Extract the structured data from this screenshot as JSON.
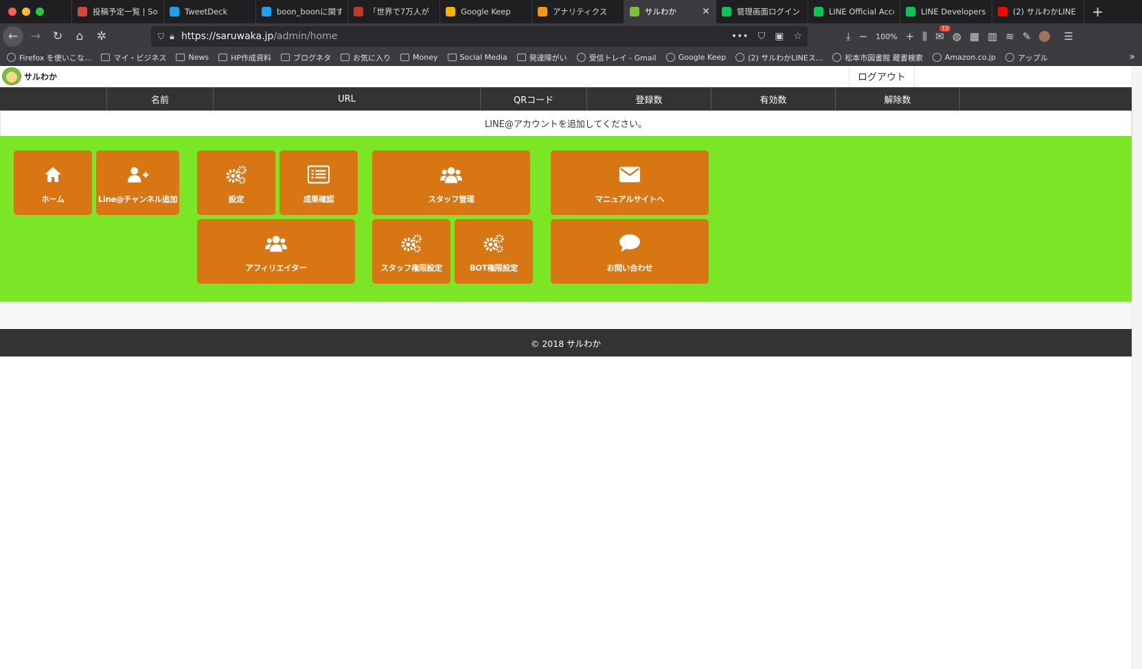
{
  "browser": {
    "tabs": [
      {
        "title": "投稿予定一覧 | So",
        "fav_color": "#d14b3a",
        "fav_glyph": "◔",
        "icon": "socialdog-icon"
      },
      {
        "title": "TweetDeck",
        "fav_color": "#1da1f2",
        "fav_glyph": "🐦",
        "icon": "twitter-icon"
      },
      {
        "title": "boon_boonに関す",
        "fav_color": "#1da1f2",
        "fav_glyph": "🐦",
        "icon": "twitter-icon"
      },
      {
        "title": "「世界で7万人が",
        "fav_color": "#c0392b",
        "fav_glyph": "ω",
        "icon": "article-icon"
      },
      {
        "title": "Google Keep",
        "fav_color": "#f6b400",
        "fav_glyph": "●",
        "icon": "google-keep-icon"
      },
      {
        "title": "アナリティクス",
        "fav_color": "#f29b00",
        "fav_glyph": "▮",
        "icon": "analytics-icon"
      },
      {
        "title": "サルわか",
        "fav_color": "#7bbf3a",
        "fav_glyph": "●",
        "icon": "saruwaka-icon",
        "active": true
      },
      {
        "title": "管理画面ログイン",
        "fav_color": "#06c755",
        "fav_glyph": "●",
        "icon": "line-icon"
      },
      {
        "title": "LINE Official Acco",
        "fav_color": "#06c755",
        "fav_glyph": "L",
        "icon": "line-official-icon"
      },
      {
        "title": "LINE Developers",
        "fav_color": "#06c755",
        "fav_glyph": "‹›",
        "icon": "line-developers-icon"
      },
      {
        "title": "(2) サルわかLINE",
        "fav_color": "#ff0000",
        "fav_glyph": "▶",
        "icon": "youtube-icon"
      }
    ],
    "url_host": "https://saruwaka.jp",
    "url_path": "/admin/home",
    "zoom": "100%",
    "notification_count": "12",
    "bookmarks": [
      {
        "label": "Firefox を使いこな...",
        "icon": "firefox-icon"
      },
      {
        "label": "マイ・ビジネス",
        "icon": "folder-icon"
      },
      {
        "label": "News",
        "icon": "folder-icon"
      },
      {
        "label": "HP作成資料",
        "icon": "folder-icon"
      },
      {
        "label": "ブログネタ",
        "icon": "folder-icon"
      },
      {
        "label": "お気に入り",
        "icon": "folder-icon"
      },
      {
        "label": "Money",
        "icon": "folder-icon"
      },
      {
        "label": "Social Media",
        "icon": "folder-icon"
      },
      {
        "label": "発達障がい",
        "icon": "folder-icon"
      },
      {
        "label": "受信トレイ - Gmail",
        "icon": "gmail-icon"
      },
      {
        "label": "Google Keep",
        "icon": "google-keep-icon"
      },
      {
        "label": "(2) サルわかLINEス...",
        "icon": "youtube-icon"
      },
      {
        "label": "松本市図書館 蔵書検索",
        "icon": "globe-icon"
      },
      {
        "label": "Amazon.co.jp",
        "icon": "amazon-icon"
      },
      {
        "label": "アップル",
        "icon": "apple-icon"
      }
    ]
  },
  "header": {
    "logo_text": "サルわか",
    "logout_label": "ログアウト"
  },
  "table": {
    "columns": [
      "",
      "名前",
      "URL",
      "QRコード",
      "登録数",
      "有効数",
      "解除数",
      ""
    ],
    "empty_message": "LINE@アカウントを追加してください。"
  },
  "tiles": [
    {
      "label": "ホーム",
      "icon": "home-icon"
    },
    {
      "label": "Line@チャンネル追加",
      "icon": "add-user-icon"
    },
    {
      "label": "設定",
      "icon": "gears-icon"
    },
    {
      "label": "成果確認",
      "icon": "list-icon"
    },
    {
      "label": "スタッフ管理",
      "icon": "users-icon"
    },
    {
      "label": "マニュアルサイトへ",
      "icon": "envelope-icon"
    },
    {
      "label": "アフィリエイター",
      "icon": "users-icon"
    },
    {
      "label": "スタッフ権限設定",
      "icon": "gears-icon"
    },
    {
      "label": "BOT権限設定",
      "icon": "gears-icon"
    },
    {
      "label": "お問い合わせ",
      "icon": "chat-icon"
    }
  ],
  "footer": {
    "copyright": "© 2018 サルわか"
  },
  "colors": {
    "tile": "#d97614",
    "panel": "#7be626",
    "header_bar": "#333333"
  }
}
